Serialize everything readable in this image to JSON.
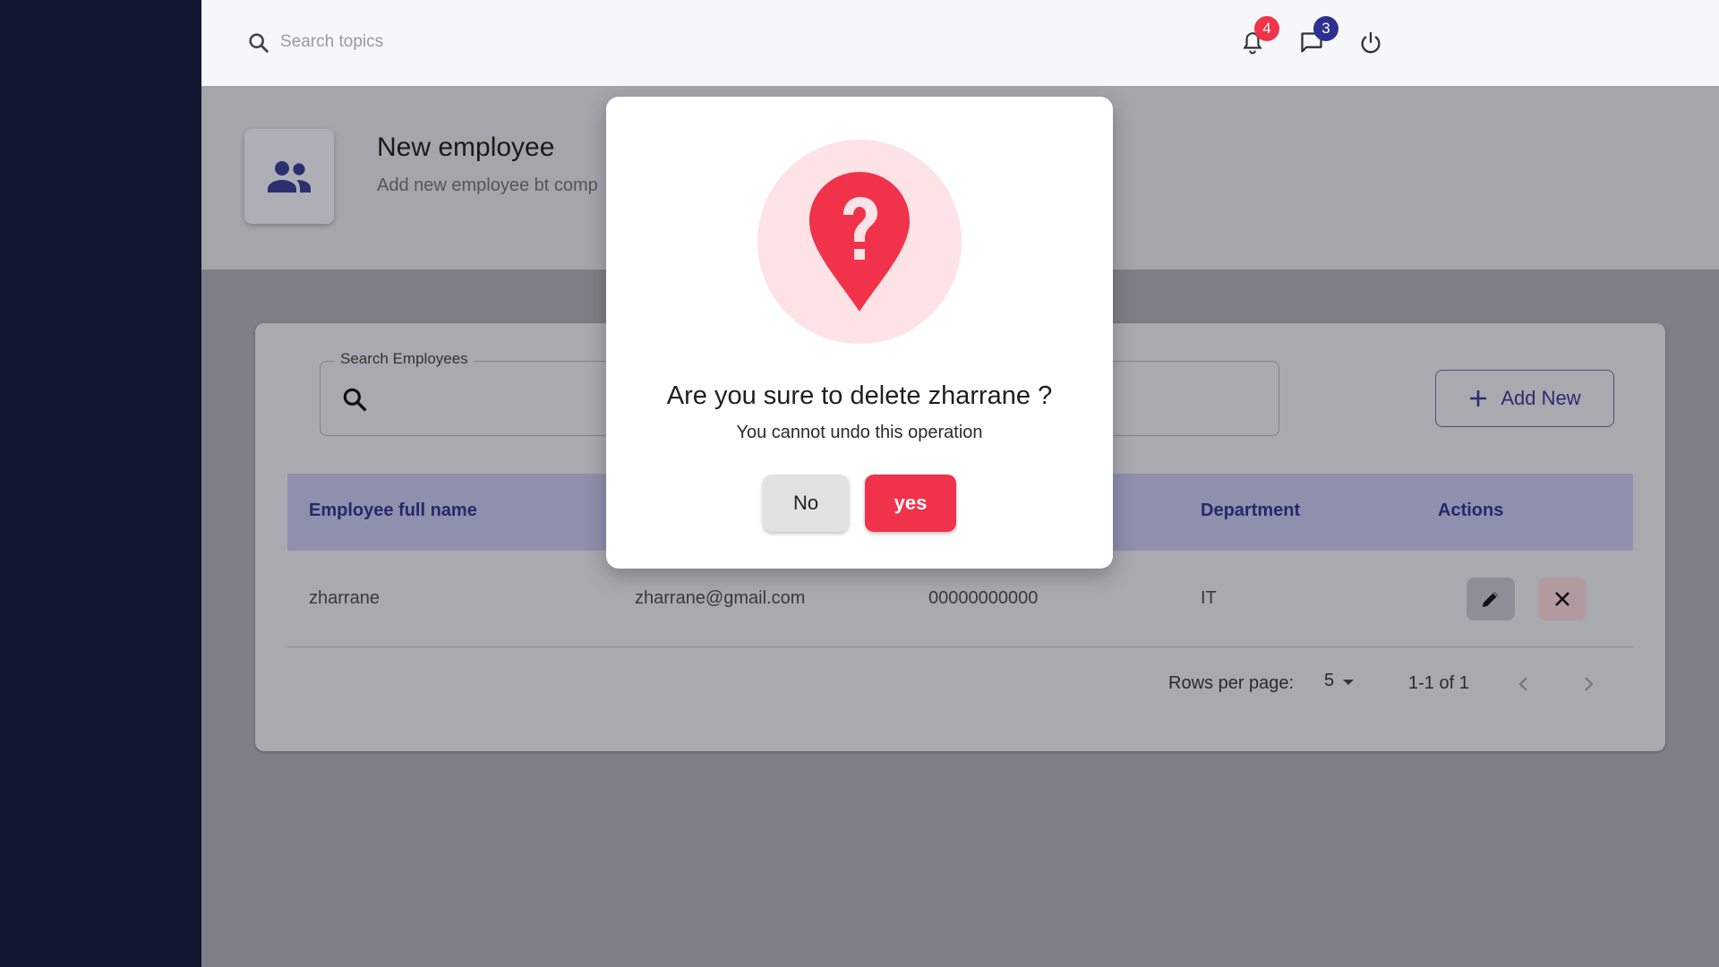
{
  "topbar": {
    "search_placeholder": "Search topics",
    "notifications_count": "4",
    "messages_count": "3",
    "icons": [
      "search-icon",
      "bell-icon",
      "chat-icon",
      "power-icon"
    ]
  },
  "header": {
    "title": "New employee",
    "subtitle": "Add new employee bt comp",
    "icon": "people-icon"
  },
  "search_employees": {
    "label": "Search Employees",
    "value": ""
  },
  "add_new_label": "Add New",
  "table": {
    "columns": [
      "Employee full name",
      "Department",
      "Actions"
    ],
    "rows": [
      {
        "name": "zharrane",
        "email": "zharrane@gmail.com",
        "phone": "00000000000",
        "department": "IT"
      }
    ]
  },
  "pagination": {
    "rows_per_page_label": "Rows per page:",
    "rows_per_page_value": "5",
    "range": "1-1 of 1"
  },
  "dialog": {
    "title": "Are you sure to delete zharrane ?",
    "subtitle": "You cannot undo this operation",
    "no_label": "No",
    "yes_label": "yes",
    "icon": "question-pin-icon"
  },
  "colors": {
    "sidebar": "#121830",
    "accent": "#2a3190",
    "danger": "#f0324a"
  }
}
